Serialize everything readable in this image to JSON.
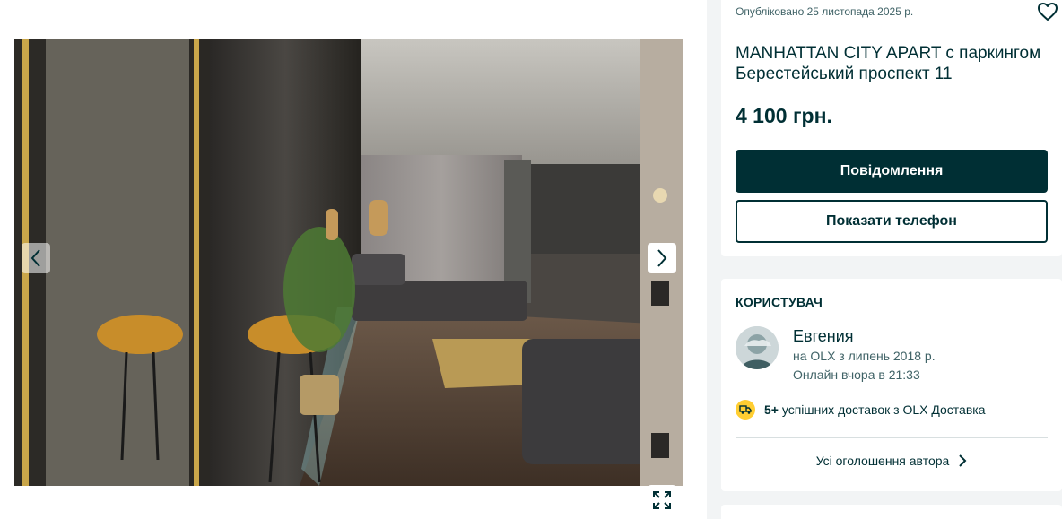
{
  "gallery": {
    "photo_alt": "Interior photo of the apartment"
  },
  "ad": {
    "published": "Опубліковано 25 листопада 2025 р.",
    "title": "MANHATTAN CITY APART с паркингом Берестейський проспект 11",
    "price": "4 100 грн.",
    "message_button": "Повідомлення",
    "phone_button": "Показати телефон"
  },
  "user": {
    "heading": "КОРИСТУВАЧ",
    "name": "Евгения",
    "since": "на OLX з липень 2018 р.",
    "online": "Онлайн вчора в 21:33",
    "delivery_count": "5+",
    "delivery_text": " успішних доставок з OLX Доставка",
    "all_ads_link": "Усі оголошення автора"
  },
  "colors": {
    "primary": "#002f34",
    "secondary_text": "#406367",
    "delivery_badge": "#ffce32",
    "background": "#f2f4f5"
  },
  "icons": {
    "favorite": "heart-icon",
    "prev": "chevron-left-icon",
    "next": "chevron-right-icon",
    "fullscreen": "expand-icon",
    "delivery": "truck-icon",
    "link_arrow": "chevron-right-icon"
  }
}
